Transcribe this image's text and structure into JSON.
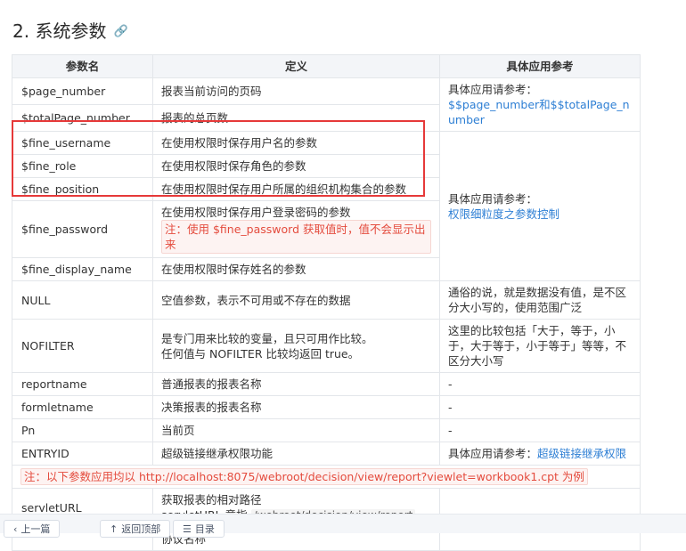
{
  "heading": {
    "title": "2. 系统参数",
    "link_icon": "link-icon"
  },
  "table": {
    "headers": [
      "参数名",
      "定义",
      "具体应用参考"
    ],
    "rows": {
      "page_number": {
        "name": "$page_number",
        "def": "报表当前访问的页码"
      },
      "totalPage_number": {
        "name": "$totalPage_number",
        "def": "报表的总页数"
      },
      "ref_page": {
        "prefix": "具体应用请参考：",
        "link": "$$page_number和$$totalPage_number"
      },
      "fine_username": {
        "name": "$fine_username",
        "def": "在使用权限时保存用户名的参数"
      },
      "fine_role": {
        "name": "$fine_role",
        "def": "在使用权限时保存角色的参数"
      },
      "fine_position": {
        "name": "$fine_position",
        "def": "在使用权限时保存用户所属的组织机构集合的参数"
      },
      "fine_password": {
        "name": "$fine_password",
        "def": "在使用权限时保存用户登录密码的参数",
        "note": "注：使用 $fine_password 获取值时，值不会显示出来"
      },
      "ref_perm": {
        "prefix": "具体应用请参考：",
        "link": "权限细粒度之参数控制"
      },
      "fine_display_name": {
        "name": "$fine_display_name",
        "def": "在使用权限时保存姓名的参数"
      },
      "null": {
        "name": "NULL",
        "def": "空值参数，表示不可用或不存在的数据",
        "ref": "通俗的说，就是数据没有值，是不区分大小写的，使用范围广泛"
      },
      "nofilter": {
        "name": "NOFILTER",
        "def_line1": "是专门用来比较的变量，且只可用作比较。",
        "def_line2": "任何值与 NOFILTER 比较均返回 true。",
        "ref": "这里的比较包括「大于，等于，小于，大于等于，小于等于」等等，不区分大小写"
      },
      "reportname": {
        "name": "reportname",
        "def": "普通报表的报表名称",
        "ref": "-"
      },
      "formletname": {
        "name": "formletname",
        "def": "决策报表的报表名称",
        "ref": "-"
      },
      "pn": {
        "name": "Pn",
        "def": "当前页",
        "ref": "-"
      },
      "entryid": {
        "name": "ENTRYID",
        "def": "超级链接继承权限功能",
        "ref_prefix": "具体应用请参考：",
        "ref_link": "超级链接继承权限"
      },
      "url_note": "注：以下参数应用均以 http://localhost:8075/webroot/decision/view/report?viewlet=workbook1.cpt  为例",
      "servleturl": {
        "name": "servletURL",
        "def_line1": "获取报表的相对路径",
        "def_line2_prefix": "servletURL 意指",
        "def_line2_code": "/webroot/decision/view/report"
      },
      "partial": {
        "def": "协议名称"
      }
    }
  },
  "bottom_bar": {
    "btn1": "上一篇",
    "btn2": "返回顶部",
    "btn3": "目录"
  }
}
